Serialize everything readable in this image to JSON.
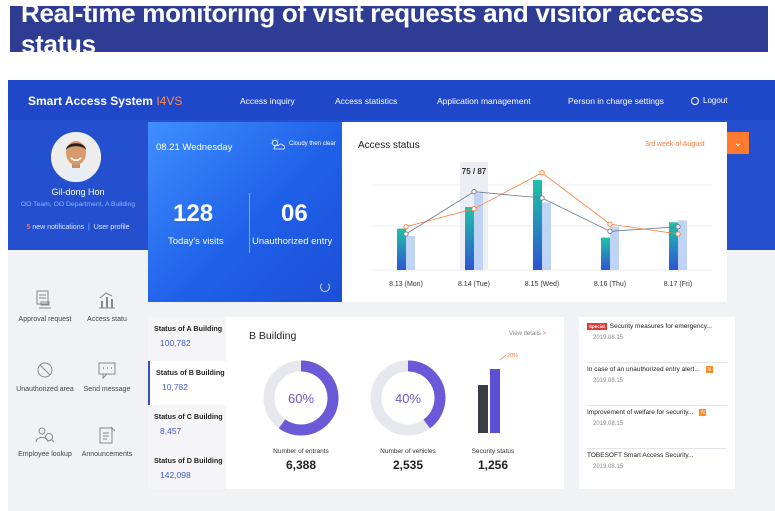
{
  "banner": {
    "title": "Real-time monitoring of visit requests and visitor access status"
  },
  "nav": {
    "brand": "Smart Access System",
    "brand_version": "I4VS",
    "items": [
      "Access inquiry",
      "Access statistics",
      "Application management",
      "Person in charge settings"
    ],
    "logout": "Logout"
  },
  "profile": {
    "name": "Gil-dong Hon",
    "org": "OO Team, OO Department, A Building",
    "notif_count": "5",
    "notif_label": " new notifications",
    "separator": "|",
    "user_profile": "User profile"
  },
  "today": {
    "date": "08.21 Wednesday",
    "weather": "Cloudy then clear",
    "visits_value": "128",
    "visits_label": "Today's visits",
    "unauth_value": "06",
    "unauth_label": "Unauthorized entry"
  },
  "menu": {
    "approval": "Approval request",
    "access": "Access statu",
    "unauth_area": "Unauthorized area",
    "send_message": "Send message",
    "employee_lookup": "Employee lookup",
    "announcements": "Announcements"
  },
  "chart_data": {
    "type": "bar",
    "title": "Access status",
    "subtitle": "3rd week of August",
    "categories": [
      "8.13 (Mon)",
      "8.14 (Tue)",
      "8.15 (Wed)",
      "8.16 (Thu)",
      "8.17 (Fri)"
    ],
    "highlight_label": "75 / 87",
    "highlight_index": 1,
    "series": [
      {
        "values": [
          46,
          70,
          100,
          36,
          53
        ],
        "color": "#1fb2a0"
      },
      {
        "values": [
          38,
          85,
          75,
          48,
          55
        ],
        "color": "#bfd3f5"
      }
    ],
    "lines": [
      {
        "values": [
          48,
          68,
          108,
          51,
          40
        ],
        "color": "#ff7a2e"
      },
      {
        "values": [
          40,
          87,
          80,
          43,
          48
        ],
        "color": "#6d7a90"
      }
    ],
    "ylim": [
      0,
      120
    ]
  },
  "buildings": {
    "tabs": [
      {
        "label": "Status of A Building",
        "value": "100,782"
      },
      {
        "label": "Status of B Building",
        "value": "10,782"
      },
      {
        "label": "Status of C Building",
        "value": "8,457"
      },
      {
        "label": "Status of D Building",
        "value": "142,098"
      }
    ],
    "selected": "B Building",
    "view_details": "View details",
    "entrants_pct": 60,
    "entrants_pct_label": "60%",
    "entrants_label": "Number of entrants",
    "entrants_value": "6,388",
    "vehicles_pct": 40,
    "vehicles_pct_label": "40%",
    "vehicles_label": "Number of vehicles",
    "vehicles_value": "2,535",
    "security_badge": "20%",
    "security_label": "Security status",
    "security_value": "1,256",
    "security_bars": [
      48,
      64
    ]
  },
  "news": [
    {
      "tag": "Special",
      "title": "Security measures for emergency...",
      "date": "2019.08.15"
    },
    {
      "title": "In case of an unauthorized entry alert...",
      "new": "N",
      "date": "2019.08.15"
    },
    {
      "title": "Improvement of welfare for security...",
      "new": "N",
      "date": "2019.08.15"
    },
    {
      "title": "TOBESOFT Smart Access Security...",
      "date": "2019.08.15"
    }
  ],
  "colors": {
    "banner": "#2e3c93",
    "nav": "#1f47c9",
    "accent_orange": "#ff7a2e",
    "donut": "#6a5ad8"
  }
}
